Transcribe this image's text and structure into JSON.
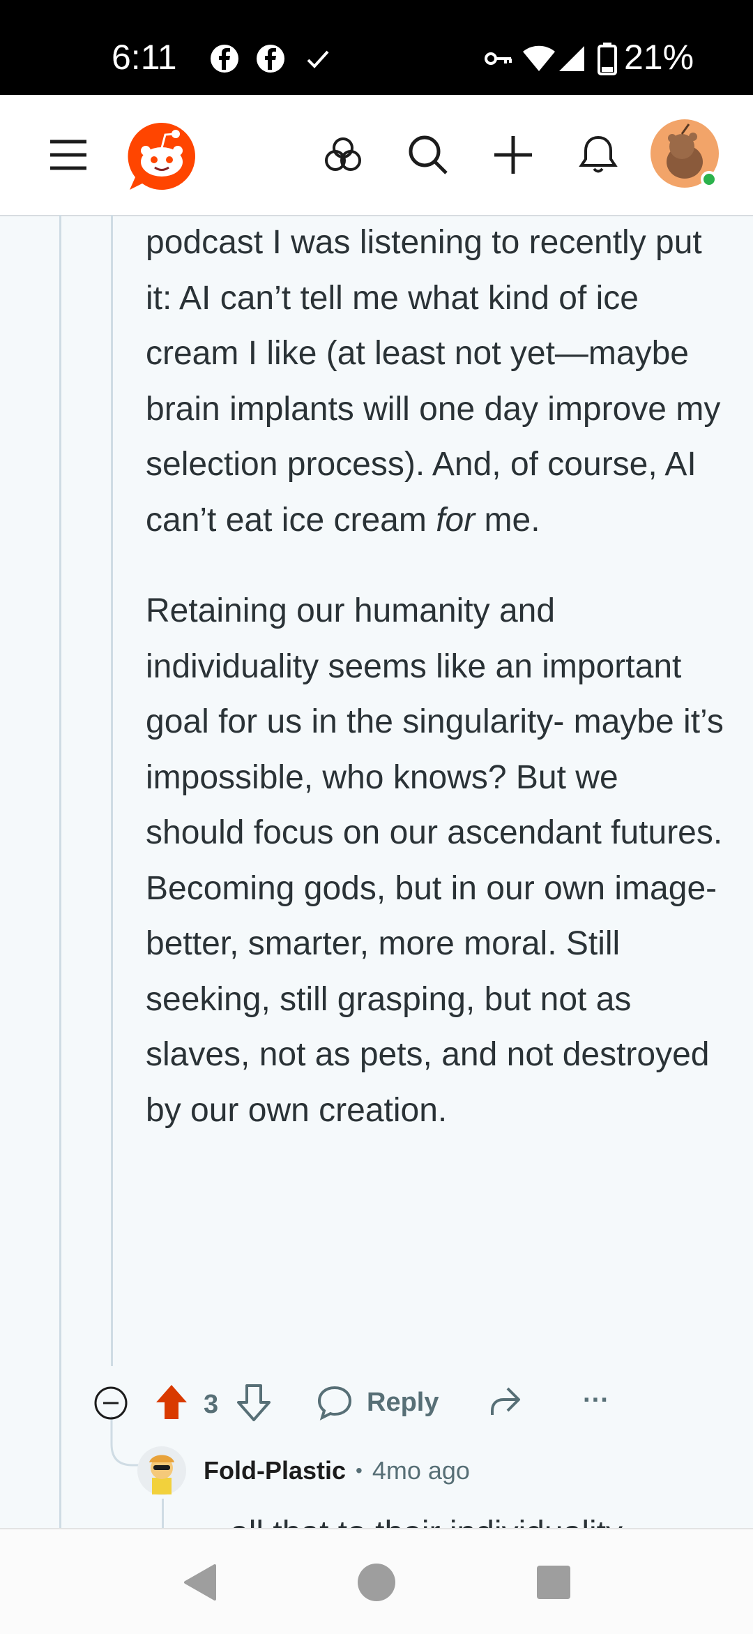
{
  "status_bar": {
    "time": "6:11",
    "battery": "21%",
    "icons": [
      "facebook-icon",
      "facebook-icon",
      "check-icon",
      "vpn-key-icon",
      "wifi-icon",
      "cell-signal-icon",
      "battery-icon"
    ]
  },
  "header": {
    "icons": [
      "menu-icon",
      "reddit-logo",
      "explore-icon",
      "search-icon",
      "create-icon",
      "notifications-icon",
      "avatar"
    ]
  },
  "comment": {
    "paragraphs": [
      {
        "text_before": "podcast I was listening to recently put it: AI can’t tell me what kind of ice cream I like (at least not yet—maybe brain implants will one day improve my selection process). And, of course, AI can’t eat ice cream ",
        "emphasis": "for",
        "text_after": " me."
      },
      {
        "text": "Retaining our humanity and individuality seems like an important goal for us in the singularity- maybe it’s impossible, who knows? But we should focus on our ascendant futures. Becoming gods, but in our own image- better, smarter, more moral. Still seeking, still grasping, but not as slaves, not as pets, and not destroyed by our own creation."
      }
    ],
    "vote_count": "3",
    "reply_label": "Reply",
    "more_label": "···"
  },
  "reply": {
    "username": "Fold-Plastic",
    "separator": "•",
    "age": "4mo ago",
    "preview_text": "...all that to their individuality"
  },
  "colors": {
    "upvote_active": "#d93a00",
    "online_dot": "#2bb24c",
    "reddit_orange": "#ff4500"
  }
}
